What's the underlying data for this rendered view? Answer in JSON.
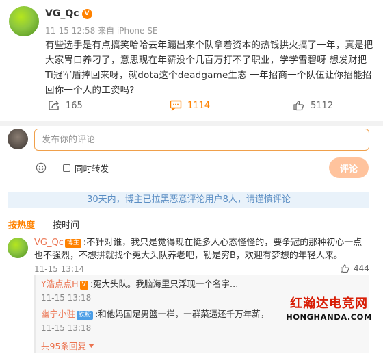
{
  "post": {
    "author": "VG_Qc",
    "badge": "V",
    "meta": "11-15 12:58 来自 iPhone SE",
    "text": "有些选手是有点搞笑哈哈去年蹦出来个队拿着资本的热钱拱火搞了一年，真是把大家胃口养刁了，意思现在年薪没个几百万打不了职业，学学雪碧呀 想发财把Ti冠军盾捧回来呀，就dota这个deadgame生态 一年招商一个队伍让你招能招回你一个人的工资吗?",
    "share_count": "165",
    "comment_count": "1114",
    "like_count": "5112"
  },
  "composer": {
    "placeholder": "发布你的评论",
    "forward_label": "同时转发",
    "submit_label": "评论"
  },
  "notice": "30天内，博主已拉黑恶意评论用户8人，请谨慎评论",
  "sort_tabs": {
    "hot": "按热度",
    "time": "按时间"
  },
  "comment": {
    "author": "VG_Qc",
    "author_tag": "博主",
    "text": ":不针对谁，我只是觉得现在挺多人心态怪怪的，要争冠的那种初心一点也不强烈，不想拼就找个冤大头队养老吧，勒是穷B，欢迎有梦想的年轻人来。",
    "time": "11-15 13:14",
    "like_count": "444"
  },
  "replies": [
    {
      "author": "Y浩点点H",
      "tag": "V",
      "text": ":冤大头队。我脑海里只浮现一个名字…",
      "time": "11-15 13:18"
    },
    {
      "author": "幽宁小驻",
      "tag": "铁粉",
      "text": ":和他妈国足男篮一样，一群菜逼还千万年薪，",
      "time": "11-15 13:18"
    }
  ],
  "more_replies": "共95条回复",
  "watermark": {
    "cn": "红瀚达电竞网",
    "en": "HONGHANDA.COM"
  },
  "colors": {
    "accent": "#ff8200",
    "name": "#eb7350",
    "notice_bg": "#e9f2fa",
    "notice_text": "#5a8dc3"
  }
}
